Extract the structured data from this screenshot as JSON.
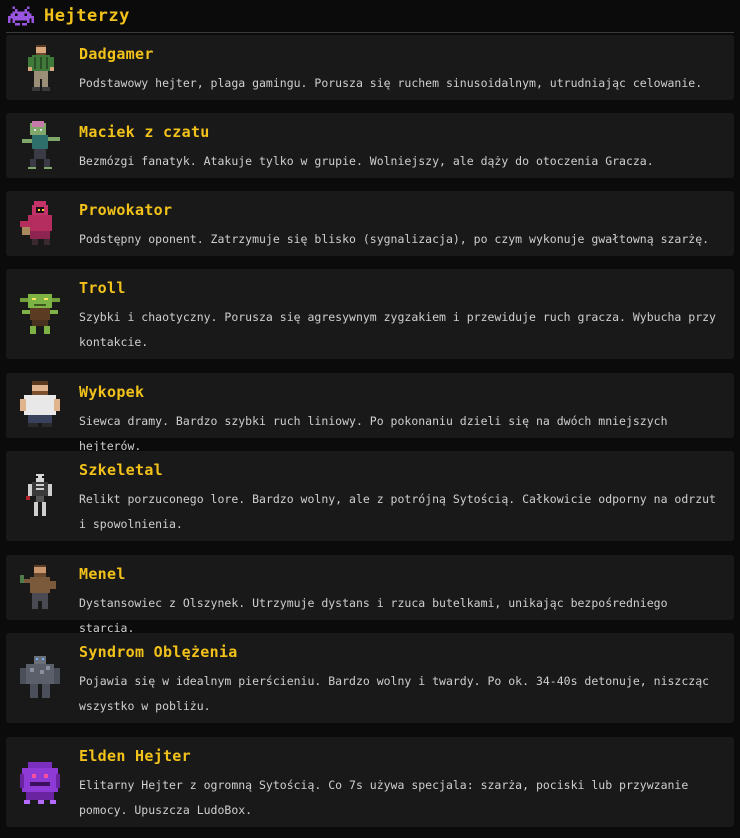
{
  "header": {
    "title": "Hejterzy",
    "icon": "space-invader-icon",
    "icon_color": "#9a55e0"
  },
  "accent_color": "#f2c21b",
  "enemies": [
    {
      "name": "Dadgamer",
      "icon": "dadgamer-sprite-icon",
      "description": "Podstawowy hejter, plaga gamingu. Porusza się ruchem sinusoidalnym, utrudniając celowanie."
    },
    {
      "name": "Maciek z czatu",
      "icon": "zombie-sprite-icon",
      "description": "Bezmózgi fanatyk. Atakuje tylko w grupie. Wolniejszy, ale dąży do otoczenia Gracza."
    },
    {
      "name": "Prowokator",
      "icon": "hooded-figure-sprite-icon",
      "description": "Podstępny oponent. Zatrzymuje się blisko (sygnalizacja), po czym wykonuje gwałtowną szarżę."
    },
    {
      "name": "Troll",
      "icon": "goblin-sprite-icon",
      "description": "Szybki i chaotyczny. Porusza się agresywnym zygzakiem i przewiduje ruch gracza. Wybucha przy kontakcie."
    },
    {
      "name": "Wykopek",
      "icon": "fat-man-sprite-icon",
      "description": "Siewca dramy. Bardzo szybki ruch liniowy. Po pokonaniu dzieli się na dwóch mniejszych hejterów."
    },
    {
      "name": "Szkeletal",
      "icon": "skeleton-sprite-icon",
      "description": "Relikt porzuconego lore. Bardzo wolny, ale z potrójną Sytością. Całkowicie odporny na odrzut i spowolnienia."
    },
    {
      "name": "Menel",
      "icon": "bum-sprite-icon",
      "description": "Dystansowiec z Olszynek. Utrzymuje dystans i rzuca butelkami, unikając bezpośredniego starcia."
    },
    {
      "name": "Syndrom Oblężenia",
      "icon": "golem-sprite-icon",
      "description": "Pojawia się w idealnym pierścieniu. Bardzo wolny i twardy. Po ok. 34-40s detonuje, niszcząc wszystko w pobliżu."
    },
    {
      "name": "Elden Hejter",
      "icon": "purple-beast-sprite-icon",
      "description": "Elitarny Hejter z ogromną Sytością. Co 7s używa specjala: szarża, pociski lub przywzanie pomocy. Upuszcza LudoBox."
    }
  ]
}
